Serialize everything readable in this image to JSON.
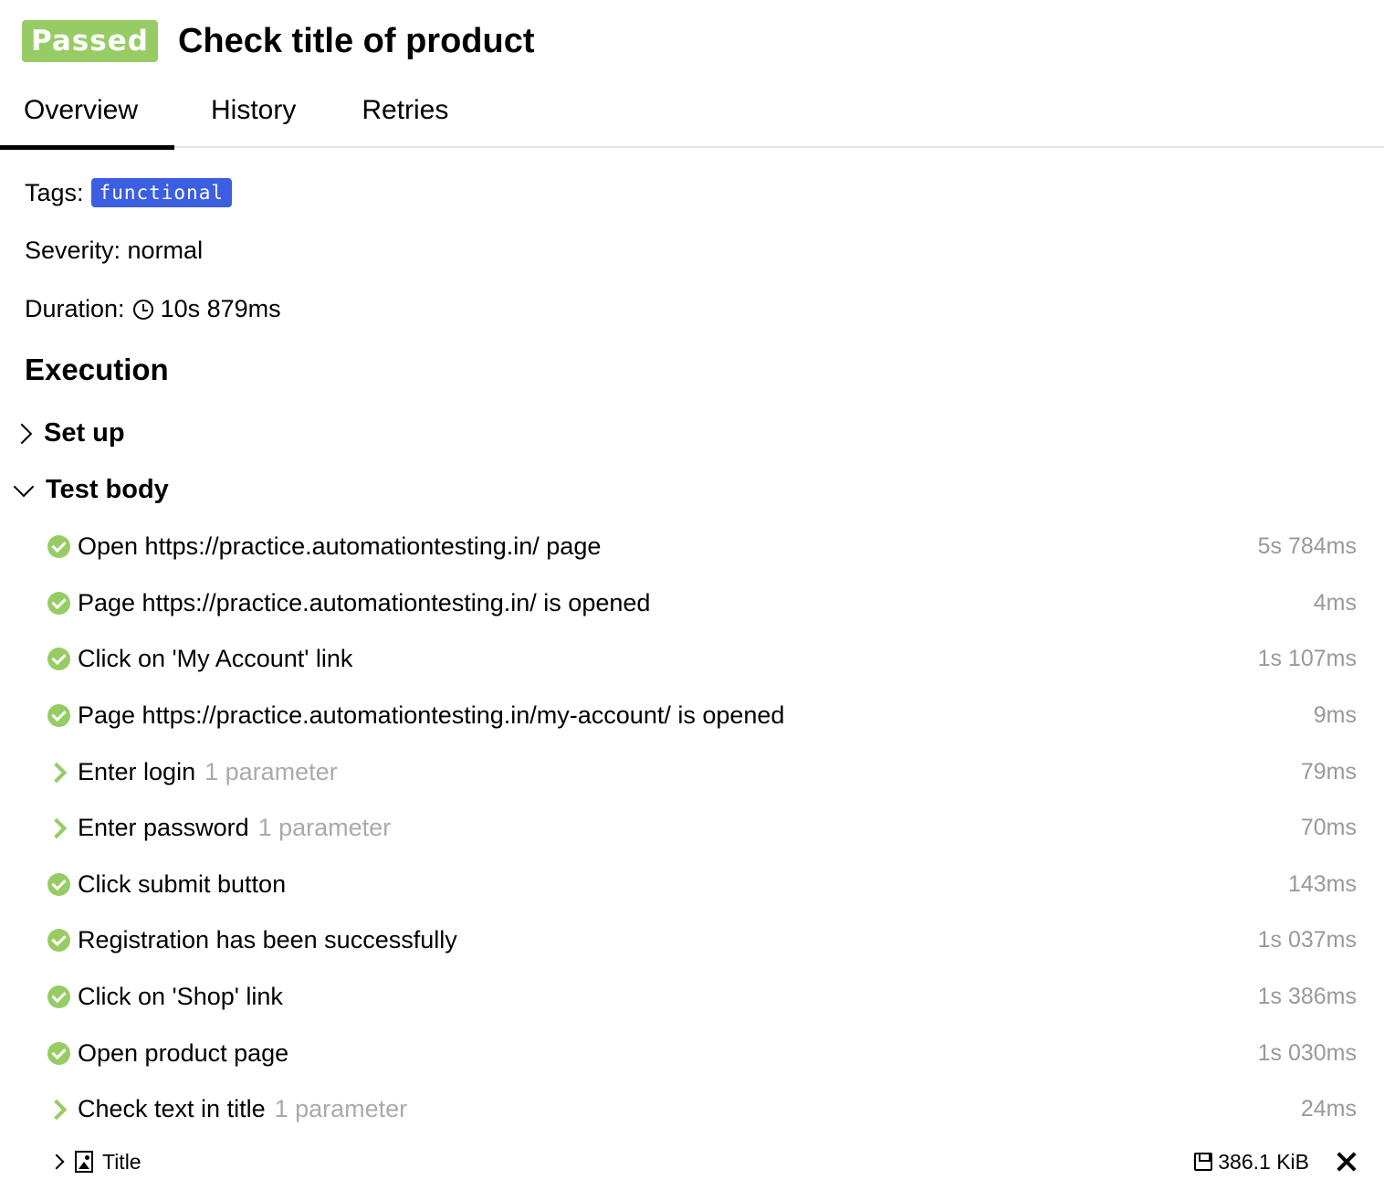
{
  "header": {
    "status": "Passed",
    "title": "Check title of product"
  },
  "tabs": [
    {
      "label": "Overview",
      "active": true
    },
    {
      "label": "History",
      "active": false
    },
    {
      "label": "Retries",
      "active": false
    }
  ],
  "meta": {
    "tags_label": "Tags:",
    "tag": "functional",
    "severity": "Severity: normal",
    "duration_label": "Duration:",
    "duration_value": "10s 879ms"
  },
  "execution": {
    "title": "Execution",
    "setup_label": "Set up",
    "body_label": "Test body",
    "steps": [
      {
        "name": "Open https://practice.automationtesting.in/ page",
        "param": "",
        "duration": "5s 784ms",
        "icon": "check-icon"
      },
      {
        "name": "Page https://practice.automationtesting.in/ is opened",
        "param": "",
        "duration": "4ms",
        "icon": "check-icon"
      },
      {
        "name": "Click on 'My Account' link",
        "param": "",
        "duration": "1s 107ms",
        "icon": "check-icon"
      },
      {
        "name": "Page https://practice.automationtesting.in/my-account/ is opened",
        "param": "",
        "duration": "9ms",
        "icon": "check-icon"
      },
      {
        "name": "Enter login",
        "param": "1 parameter",
        "duration": "79ms",
        "icon": "chevron-right-icon"
      },
      {
        "name": "Enter password",
        "param": "1 parameter",
        "duration": "70ms",
        "icon": "chevron-right-icon"
      },
      {
        "name": "Click submit button",
        "param": "",
        "duration": "143ms",
        "icon": "check-icon"
      },
      {
        "name": "Registration has been successfully",
        "param": "",
        "duration": "1s 037ms",
        "icon": "check-icon"
      },
      {
        "name": "Click on 'Shop' link",
        "param": "",
        "duration": "1s 386ms",
        "icon": "check-icon"
      },
      {
        "name": "Open product page",
        "param": "",
        "duration": "1s 030ms",
        "icon": "check-icon"
      },
      {
        "name": "Check text in title",
        "param": "1 parameter",
        "duration": "24ms",
        "icon": "chevron-right-icon"
      }
    ],
    "attachment": {
      "name": "Title",
      "size": "386.1 KiB"
    }
  },
  "colors": {
    "passed": "#97cc64",
    "tag": "#3c5ee0",
    "muted": "#999999"
  }
}
